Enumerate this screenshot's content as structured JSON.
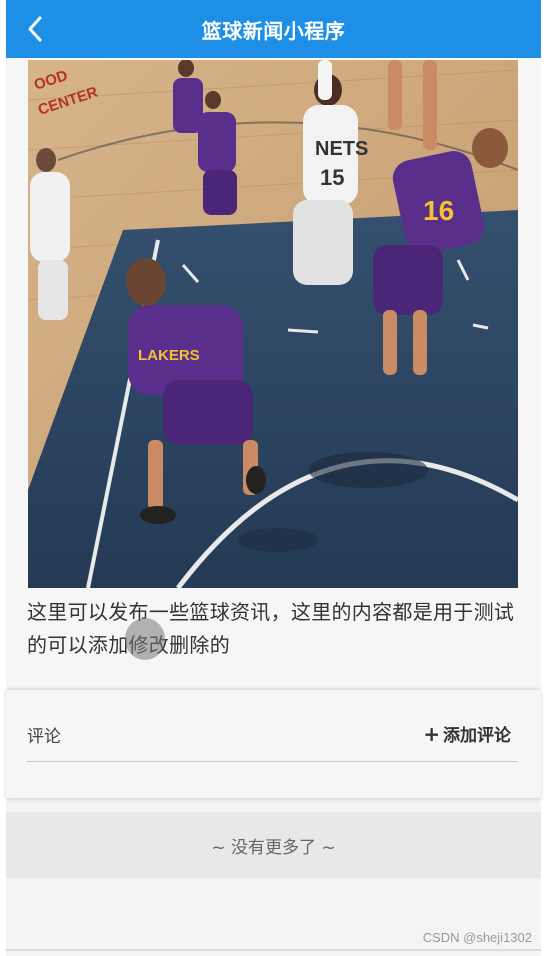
{
  "header": {
    "title": "篮球新闻小程序",
    "back_icon": "chevron-left-icon",
    "background_color": "#1e8fe6"
  },
  "article": {
    "image_description": "basketball game photo",
    "body": "这里可以发布一些篮球资讯，这里的内容都是用于测试的可以添加修改删除的"
  },
  "comments": {
    "label": "评论",
    "add_label": "添加评论",
    "add_icon": "plus-icon"
  },
  "footer": {
    "no_more": "~ 没有更多了 ~"
  },
  "watermark": "CSDN @sheji1302"
}
